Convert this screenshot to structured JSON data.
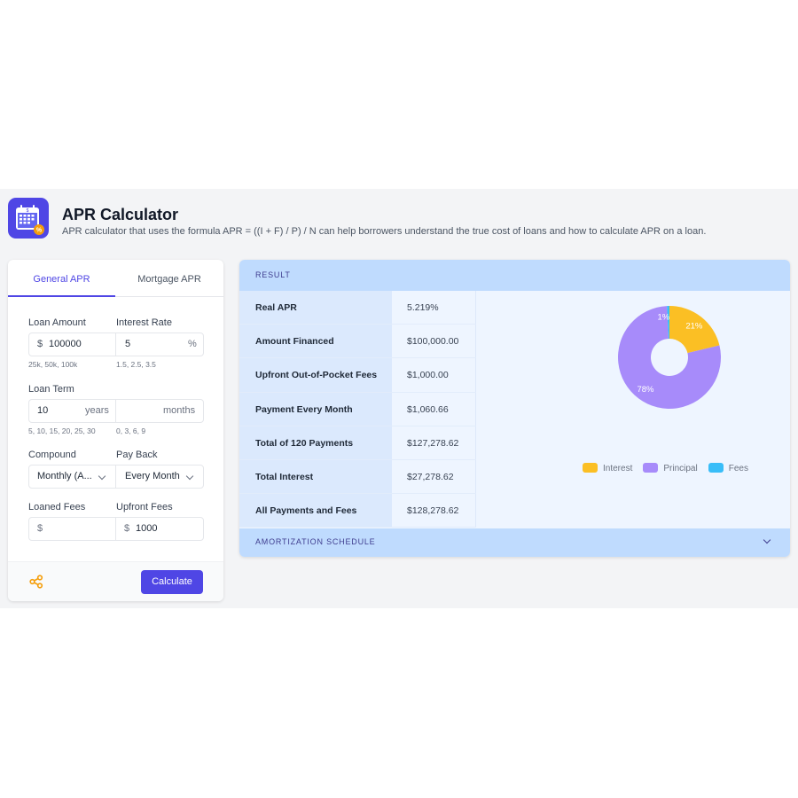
{
  "header": {
    "title": "APR Calculator",
    "subtitle": "APR calculator that uses the formula APR = ((I + F) / P) / N can help borrowers understand the true cost of loans and how to calculate APR on a loan.",
    "icon": "calendar-percent-icon"
  },
  "tabs": [
    {
      "label": "General APR",
      "active": true
    },
    {
      "label": "Mortgage APR",
      "active": false
    }
  ],
  "form": {
    "loan_amount": {
      "label": "Loan Amount",
      "prefix": "$",
      "value": "100000",
      "hint": "25k, 50k, 100k"
    },
    "interest_rate": {
      "label": "Interest Rate",
      "value": "5",
      "suffix": "%",
      "hint": "1.5, 2.5, 3.5"
    },
    "loan_term": {
      "label": "Loan Term",
      "years_value": "10",
      "years_unit": "years",
      "months_value": "",
      "months_unit": "months",
      "years_hint": "5, 10, 15, 20, 25, 30",
      "months_hint": "0, 3, 6, 9"
    },
    "compound": {
      "label": "Compound",
      "value": "Monthly (A..."
    },
    "pay_back": {
      "label": "Pay Back",
      "value": "Every Month"
    },
    "loaned_fees": {
      "label": "Loaned Fees",
      "prefix": "$",
      "value": ""
    },
    "upfront_fees": {
      "label": "Upfront Fees",
      "prefix": "$",
      "value": "1000"
    },
    "calculate_label": "Calculate",
    "share_icon": "share-icon"
  },
  "result": {
    "heading": "RESULT",
    "rows": [
      {
        "label": "Real APR",
        "value": "5.219%"
      },
      {
        "label": "Amount Financed",
        "value": "$100,000.00"
      },
      {
        "label": "Upfront Out-of-Pocket Fees",
        "value": "$1,000.00"
      },
      {
        "label": "Payment Every Month",
        "value": "$1,060.66"
      },
      {
        "label": "Total of 120 Payments",
        "value": "$127,278.62"
      },
      {
        "label": "Total Interest",
        "value": "$27,278.62"
      },
      {
        "label": "All Payments and Fees",
        "value": "$128,278.62"
      }
    ],
    "amortization_label": "AMORTIZATION SCHEDULE"
  },
  "colors": {
    "accent": "#4f46e5",
    "interest": "#fbbf24",
    "principal": "#a78bfa",
    "fees": "#38bdf8"
  },
  "chart_data": {
    "type": "pie",
    "donut": true,
    "categories": [
      "Interest",
      "Principal",
      "Fees"
    ],
    "values": [
      27278.62,
      100000,
      1000
    ],
    "labels": [
      "21%",
      "78%",
      "1%"
    ],
    "legend": "bottom"
  }
}
